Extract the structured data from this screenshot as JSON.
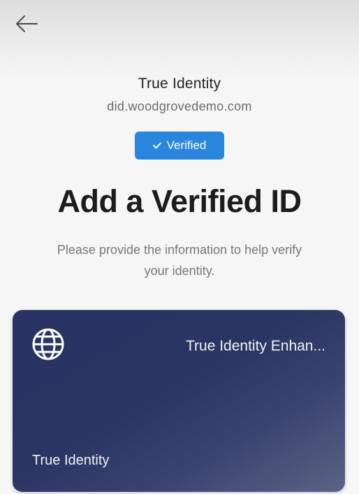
{
  "nav": {
    "back_icon": "arrow-left-icon"
  },
  "issuer": {
    "name": "True Identity",
    "domain": "did.woodgrovedemo.com"
  },
  "badge": {
    "label": "Verified",
    "icon": "checkmark-icon",
    "color": "#2a86dd"
  },
  "header": {
    "title": "Add a Verified ID",
    "subtitle_line1": "Please provide the information to help verify",
    "subtitle_line2": "your identity."
  },
  "card": {
    "title": "True Identity Enhan...",
    "issuer": "True Identity",
    "icon": "globe-icon",
    "color": "#2a3464"
  }
}
